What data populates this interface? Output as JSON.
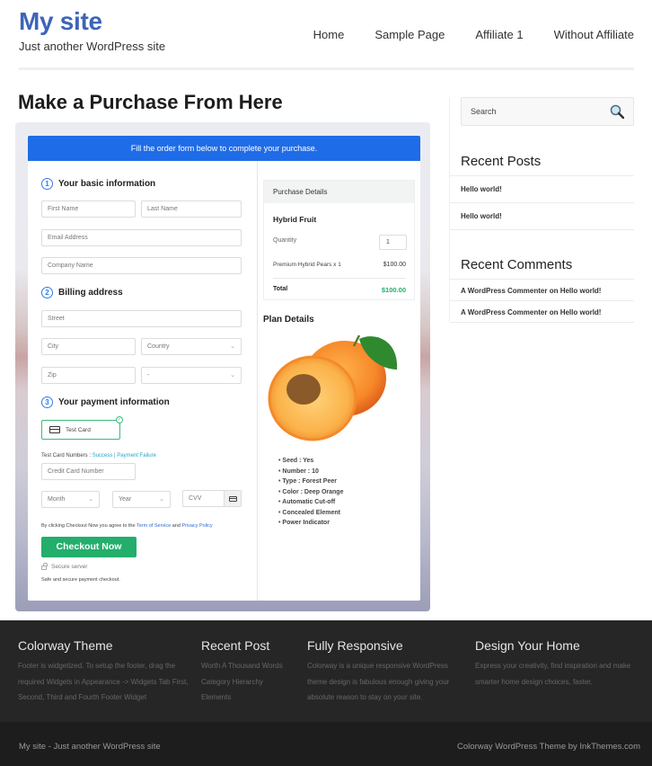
{
  "header": {
    "site_title": "My site",
    "site_description": "Just another WordPress site",
    "nav": [
      "Home",
      "Sample Page",
      "Affiliate 1",
      "Without Affiliate"
    ]
  },
  "main": {
    "page_title": "Make a Purchase From Here",
    "checkout": {
      "banner": "Fill the order form below to complete your purchase.",
      "steps": [
        {
          "num": "1",
          "label": "Your basic information"
        },
        {
          "num": "2",
          "label": "Billing address"
        },
        {
          "num": "3",
          "label": "Your payment information"
        }
      ],
      "fields": {
        "first_name": "First Name",
        "last_name": "Last Name",
        "email": "Email Address",
        "company": "Company Name",
        "street": "Street",
        "city": "City",
        "country": "Country",
        "zip": "Zip",
        "state": "-",
        "card_number": "Credit Card Number",
        "month": "Month",
        "year": "Year",
        "cvv": "CVV"
      },
      "payment_method": "Test Card",
      "test_cards": {
        "prefix": "Test Card Numbers : ",
        "success": "Success",
        "separator": " | ",
        "failure": "Payment Failure"
      },
      "agreement": {
        "prefix": "By clicking Checkout Now you agree to the ",
        "tos": "Term of Service",
        "and": " and ",
        "privacy": "Privacy Policy"
      },
      "checkout_button": "Checkout Now",
      "secure_server": "Secure server",
      "safe_text": "Safe and secure payment checkout."
    },
    "purchase_details": {
      "title": "Purchase Details",
      "product": "Hybrid Fruit",
      "quantity_label": "Quantity",
      "quantity": "1",
      "line_item": "Premium Hybrid Pears x 1",
      "line_price": "$100.00",
      "total_label": "Total",
      "total_value": "$100.00"
    },
    "plan": {
      "title": "Plan Details",
      "image": "apricot-fruit-image",
      "features": [
        "Seed : Yes",
        "Number : 10",
        "Type : Forest Peer",
        "Color : Deep Orange",
        "Automatic Cut-off",
        "Concealed Element",
        "Power Indicator"
      ]
    }
  },
  "sidebar": {
    "search_placeholder": "Search",
    "recent_posts_title": "Recent Posts",
    "recent_posts": [
      "Hello world!",
      "Hello world!"
    ],
    "recent_comments_title": "Recent Comments",
    "recent_comments": [
      "A WordPress Commenter on Hello world!",
      "A WordPress Commenter on Hello world!"
    ]
  },
  "footer": {
    "columns": [
      {
        "title": "Colorway Theme",
        "text": "Footer is widgetized. To setup the footer, drag the required Widgets in Appearance -> Widgets Tab First, Second, Third and Fourth Footer Widget"
      },
      {
        "title": "Recent Post",
        "links": [
          "Worth A Thousand Words",
          "Category Hierarchy",
          "Elements"
        ]
      },
      {
        "title": "Fully Responsive",
        "text": "Colorway is a unique responsive WordPress theme design is fabulous enough giving your absolute reason to stay on your site."
      },
      {
        "title": "Design Your Home",
        "text": "Express your creativity, find inspiration and make smarter home design choices, faster."
      }
    ],
    "bottom_left": "My site - Just another WordPress site",
    "bottom_right": "Colorway WordPress Theme by InkThemes.com"
  },
  "colors": {
    "brand": "#3d64b8",
    "banner": "#1f6ce8",
    "checkout": "#23ae6b",
    "footer": "#262626"
  }
}
